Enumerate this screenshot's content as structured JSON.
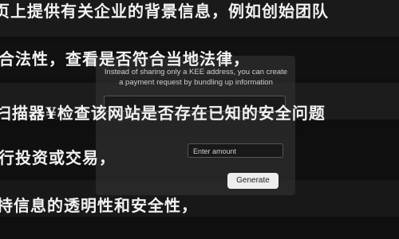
{
  "overlay": {
    "line1": "页上提供有关企业的背景信息，例如创始团队",
    "line2": "合法性，查看是否符合当地法律，",
    "line3": "扫描器¥检查该网站是否存在已知的安全问题",
    "line4": "行投资或交易，",
    "line5": "持信息的透明性和安全性，"
  },
  "card": {
    "description": "Instead of sharing only a KEE address, you can create a payment request by bundling up information",
    "input_small_placeholder": "Enter amount",
    "generate_label": "Generate"
  }
}
